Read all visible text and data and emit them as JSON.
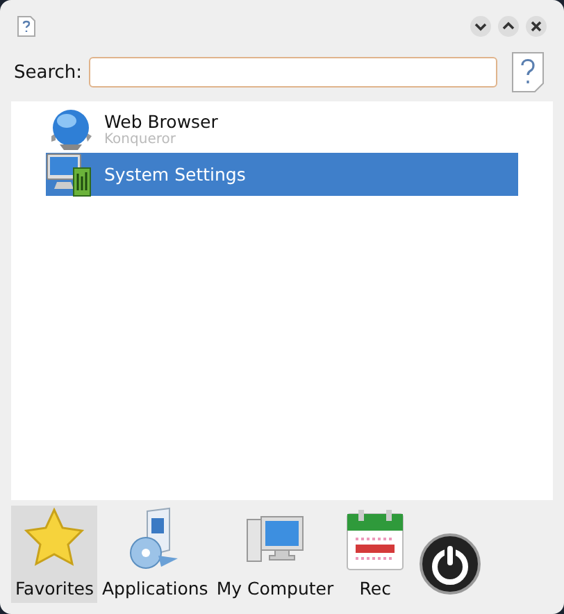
{
  "header": {
    "buttons": [
      {
        "kind": "down"
      },
      {
        "kind": "up"
      },
      {
        "kind": "close"
      }
    ]
  },
  "search": {
    "label": "Search:"
  },
  "items": [
    {
      "kind": "globe",
      "title": "Web Browser",
      "subtitle": "Konqueror",
      "selected": false
    },
    {
      "kind": "settings",
      "title": "System Settings",
      "selected": true
    }
  ],
  "tabs": [
    {
      "kind": "star",
      "label": "Favorites",
      "selected": true
    },
    {
      "kind": "apps",
      "label": "Applications",
      "selected": false
    },
    {
      "kind": "computer",
      "label": "My Computer",
      "selected": false
    },
    {
      "kind": "calendar",
      "label": "Rec",
      "selected": false
    },
    {
      "kind": "power",
      "selected": false
    }
  ]
}
